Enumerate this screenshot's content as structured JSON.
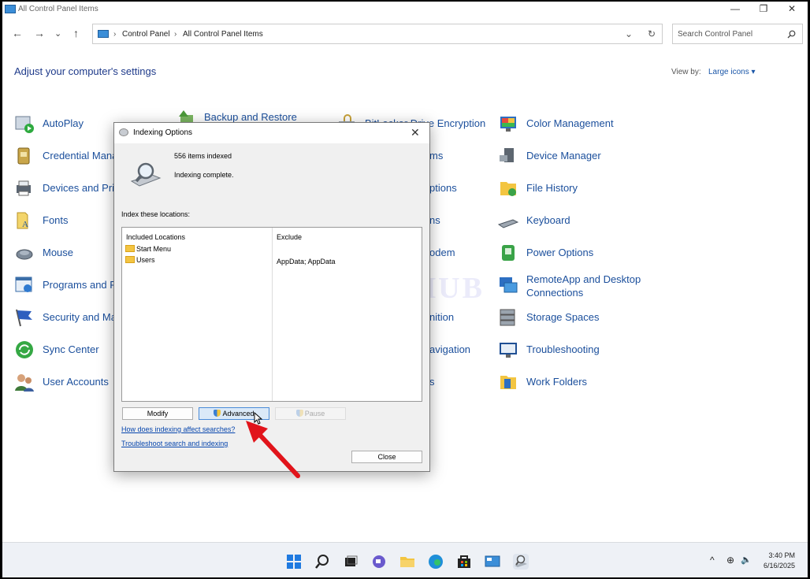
{
  "window": {
    "title": "All Control Panel Items",
    "minimize_glyph": "—",
    "restore_glyph": "❐",
    "close_glyph": "✕"
  },
  "nav": {
    "back": "←",
    "forward": "→",
    "recent": "⌄",
    "up": "↑",
    "breadcrumb": [
      "Control Panel",
      "All Control Panel Items"
    ],
    "separator": "›",
    "dropdown": "⌄",
    "refresh": "↻",
    "search_placeholder": "Search Control Panel"
  },
  "header": {
    "title": "Adjust your computer's settings",
    "view_by_label": "View by:",
    "view_by_value": "Large icons ▾"
  },
  "items": {
    "autoplay": "AutoPlay",
    "backup_restore": "Backup and Restore",
    "bitlocker": "BitLocker Drive Encryption",
    "color_management": "Color Management",
    "credential_manager": "Credential Mana",
    "device_manager": "Device Manager",
    "devices_printers": "Devices and Pri",
    "file_history": "File History",
    "fonts": "Fonts",
    "keyboard": "Keyboard",
    "mouse": "Mouse",
    "power_options": "Power Options",
    "programs_features": "Programs and F",
    "remoteapp_1": "RemoteApp and Desktop",
    "remoteapp_2": "Connections",
    "security_maintenance": "Security and Ma",
    "storage_spaces": "Storage Spaces",
    "sync_center": "Sync Center",
    "troubleshooting": "Troubleshooting",
    "user_accounts": "User Accounts",
    "work_folders": "Work Folders",
    "partial_ms": "ms",
    "partial_options": "ptions",
    "partial_ns": "ns",
    "partial_odem": "odem",
    "partial_nition": "nition",
    "partial_avigation": "avigation",
    "partial_s": "s"
  },
  "dialog": {
    "title": "Indexing Options",
    "close_glyph": "✕",
    "items_indexed": "556 items indexed",
    "status": "Indexing complete.",
    "locations_label": "Index these locations:",
    "col_included": "Included Locations",
    "col_exclude": "Exclude",
    "locations": [
      {
        "name": "Start Menu",
        "exclude": ""
      },
      {
        "name": "Users",
        "exclude": "AppData; AppData"
      }
    ],
    "modify": "Modify",
    "advanced": "Advanced",
    "pause": "Pause",
    "link_affect": "How does indexing affect searches?",
    "link_troubleshoot": "Troubleshoot search and indexing",
    "close": "Close"
  },
  "watermark": "IT Pros HUB",
  "taskbar": {
    "time": "3:40 PM",
    "date": "6/16/2025",
    "tray_chevron": "^",
    "globe_glyph": "⊕",
    "volume_glyph": "🔈"
  }
}
